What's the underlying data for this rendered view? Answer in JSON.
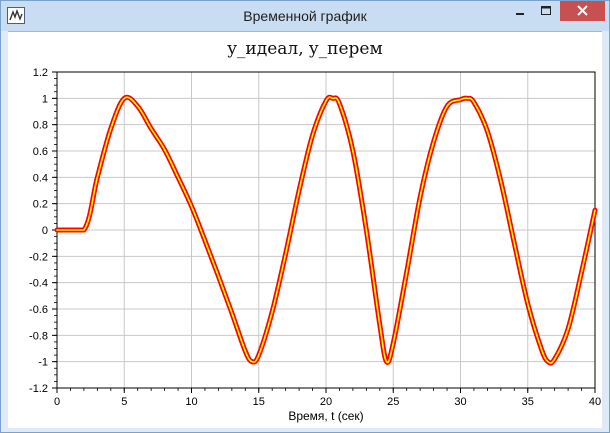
{
  "window": {
    "title": "Временной график",
    "icon": "app-graph-icon",
    "controls": {
      "minimize": "minimize-icon",
      "maximize": "maximize-icon",
      "close": "close-icon"
    }
  },
  "colors": {
    "line_outer": "#ff0000",
    "line_inner": "#ffff00",
    "grid": "#c8c8c8",
    "close_button": "#c75050"
  },
  "chart_data": {
    "type": "line",
    "title": "y_идеал, y_перем",
    "xlabel": "Время, t (сек)",
    "ylabel": "",
    "xlim": [
      0,
      40
    ],
    "ylim": [
      -1.2,
      1.2
    ],
    "x_ticks": [
      0,
      5,
      10,
      15,
      20,
      25,
      30,
      35,
      40
    ],
    "y_ticks": [
      1.2,
      1,
      0.8,
      0.6,
      0.4,
      0.2,
      0,
      -0.2,
      -0.4,
      -0.6,
      -0.8,
      -1,
      -1.2
    ],
    "grid": true,
    "series": [
      {
        "x": [
          0,
          2,
          3,
          4,
          5,
          6,
          7,
          8,
          9,
          10,
          11,
          12,
          13,
          14,
          14.5,
          15,
          16,
          17,
          18,
          19,
          20,
          20.5,
          21,
          22,
          23,
          24,
          24.5,
          25,
          26,
          27,
          28,
          29,
          30,
          30.5,
          31,
          32,
          33,
          34,
          35,
          36,
          36.5,
          37,
          38,
          39,
          40
        ],
        "y": [
          0,
          0,
          0.4,
          0.77,
          1.0,
          0.94,
          0.77,
          0.61,
          0.4,
          0.18,
          -0.08,
          -0.35,
          -0.63,
          -0.92,
          -1.0,
          -0.95,
          -0.62,
          -0.18,
          0.3,
          0.72,
          0.98,
          1.0,
          0.96,
          0.6,
          0.0,
          -0.72,
          -1.0,
          -0.86,
          -0.32,
          0.25,
          0.67,
          0.94,
          0.99,
          1.0,
          0.97,
          0.75,
          0.37,
          -0.1,
          -0.56,
          -0.9,
          -1.0,
          -0.98,
          -0.75,
          -0.32,
          0.15
        ]
      }
    ]
  }
}
